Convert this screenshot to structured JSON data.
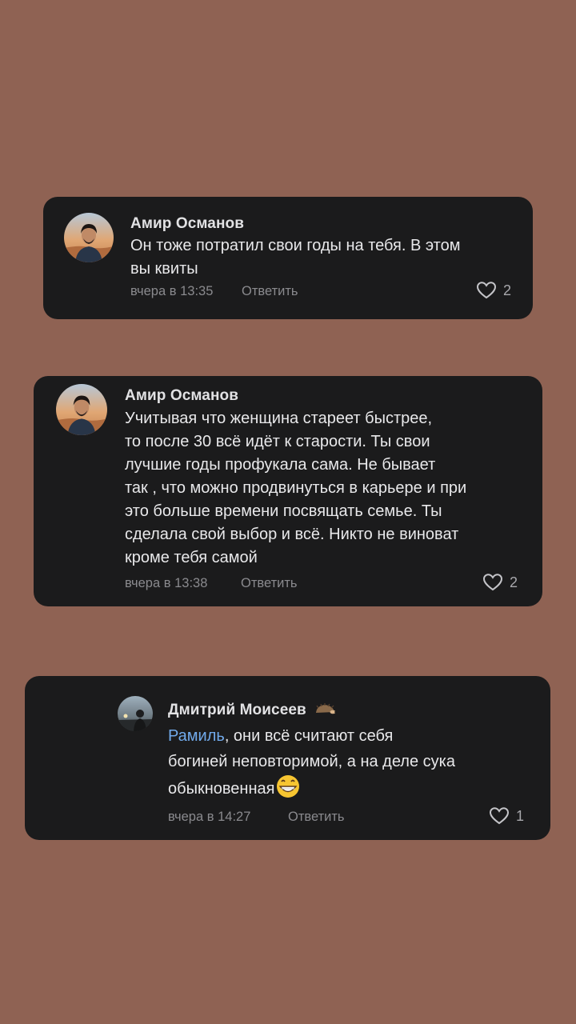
{
  "comments": [
    {
      "author": "Амир Османов",
      "lines": [
        "Он тоже потратил свои годы на тебя. В этом",
        "вы квиты"
      ],
      "time": "вчера в 13:35",
      "reply_label": "Ответить",
      "likes": "2",
      "avatar": "avatar-photo-man-desert"
    },
    {
      "author": "Амир Османов",
      "lines": [
        "Учитывая что женщина стареет быстрее,",
        "то после 30 всё идёт к старости. Ты свои",
        "лучшие годы профукала сама. Не бывает",
        "так , что можно продвинуться в карьере и при",
        "это больше времени посвящать семье. Ты",
        "сделала свой выбор и всё. Никто не виноват",
        "кроме тебя самой"
      ],
      "time": "вчера в 13:38",
      "reply_label": "Ответить",
      "likes": "2",
      "avatar": "avatar-photo-man-desert"
    },
    {
      "author": "Дмитрий Моисеев",
      "author_badge": "hedgehog-icon",
      "mention": "Рамиль",
      "line1_rest": ", они всё считают себя",
      "line2": "богиней неповторимой, а на деле сука",
      "line3": "обыкновенная",
      "emoji": "grinning-face-icon",
      "time": "вчера в 14:27",
      "reply_label": "Ответить",
      "likes": "1",
      "avatar": "avatar-photo-man-evening"
    }
  ],
  "colors": {
    "background": "#8f6253",
    "card": "#1b1b1c",
    "mention": "#71aaeb",
    "meta": "#8a8a8e"
  }
}
